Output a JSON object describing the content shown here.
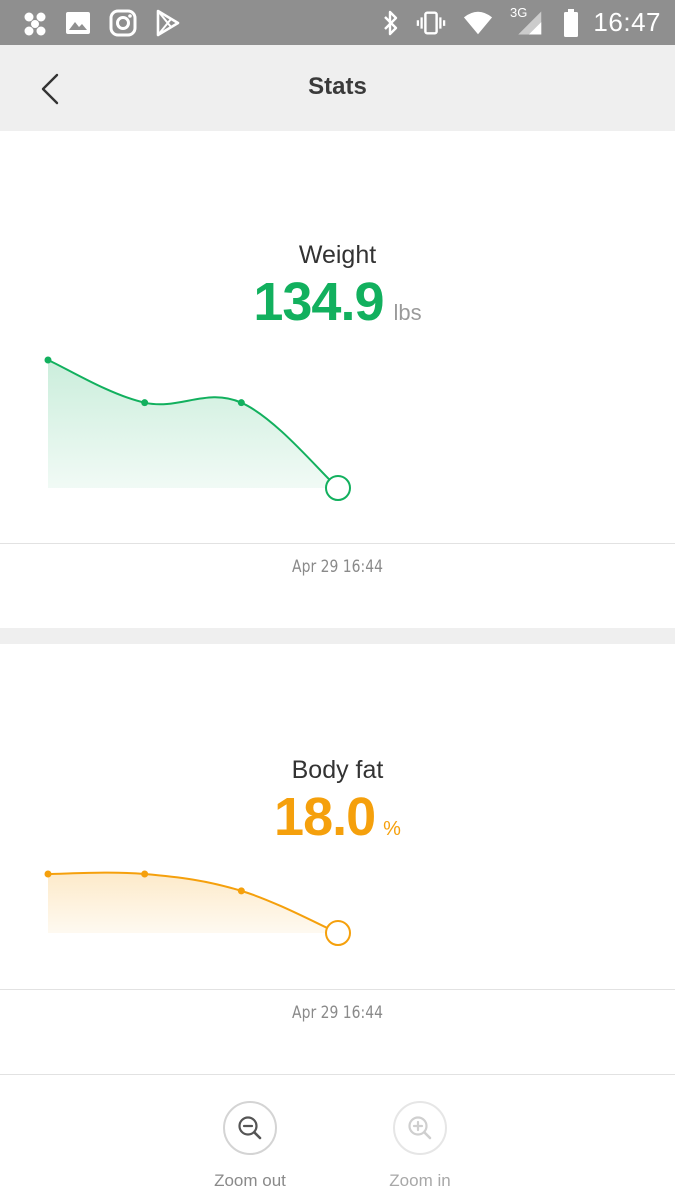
{
  "status_bar": {
    "time": "16:47",
    "network_label": "3G",
    "left_icons": [
      "app-icon",
      "image-icon",
      "instagram-icon",
      "play-store-icon"
    ],
    "right_icons": [
      "bluetooth-icon",
      "vibrate-icon",
      "wifi-icon",
      "signal-icon",
      "battery-icon"
    ]
  },
  "header": {
    "title": "Stats",
    "back_icon": "chevron-left-icon"
  },
  "colors": {
    "weight": "#12b05e",
    "body_fat": "#f5a00c",
    "status_bar": "#8f8f8f",
    "header_bg": "#efefef"
  },
  "weight": {
    "label": "Weight",
    "value": "134.9",
    "unit": "lbs",
    "date": "Apr 29 16:44"
  },
  "body_fat": {
    "label": "Body fat",
    "value": "18.0",
    "unit": "%",
    "date": "Apr 29 16:44"
  },
  "chart_data": [
    {
      "type": "area",
      "series": [
        {
          "values": [
            137.9,
            136.9,
            136.9,
            134.9
          ]
        }
      ],
      "grid": false,
      "ylim": [
        134.9,
        137.9
      ]
    },
    {
      "type": "area",
      "series": [
        {
          "values": [
            19.4,
            19.4,
            19.0,
            18.0
          ]
        }
      ],
      "grid": false,
      "ylim": [
        18.0,
        19.4
      ]
    }
  ],
  "bottom_bar": {
    "zoom_out_label": "Zoom out",
    "zoom_in_label": "Zoom in"
  }
}
